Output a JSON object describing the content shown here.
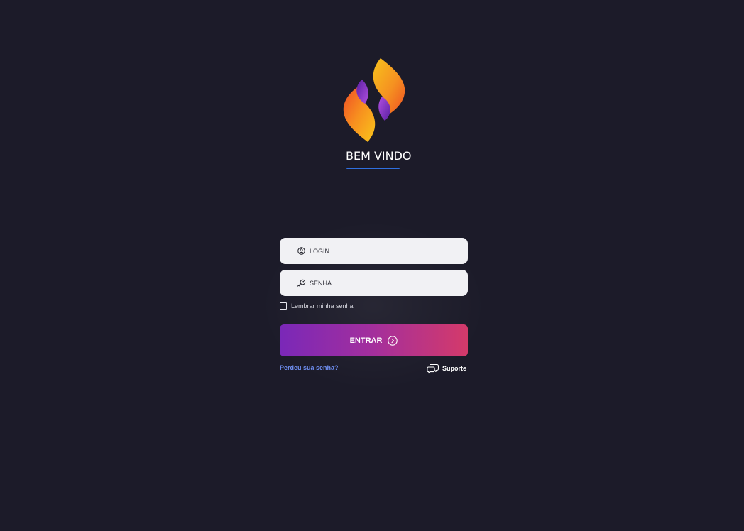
{
  "brand": {
    "logo_icon": "flame-s-logo-icon",
    "welcome_text": "BEM VINDO",
    "accent_underline_color": "#2f6fe0",
    "logo_colors": [
      "#f7b21a",
      "#f05a1e",
      "#7b2fbe",
      "#a83fd6"
    ]
  },
  "form": {
    "login": {
      "placeholder": "LOGIN",
      "value": "",
      "icon": "user-circle-icon"
    },
    "password": {
      "placeholder": "SENHA",
      "value": "",
      "icon": "key-icon"
    },
    "remember": {
      "label": "Lembrar minha senha",
      "checked": false
    },
    "submit": {
      "label": "ENTRAR",
      "icon": "arrow-right-circle-icon",
      "gradient": [
        "#7a28b8",
        "#d43a6a"
      ]
    }
  },
  "footer": {
    "forgot_label": "Perdeu sua senha?",
    "support_label": "Suporte",
    "support_icon": "chat-bubbles-icon"
  },
  "colors": {
    "background": "#1c1b29",
    "field_background": "#f1f1f4",
    "link": "#6f8ff2"
  }
}
